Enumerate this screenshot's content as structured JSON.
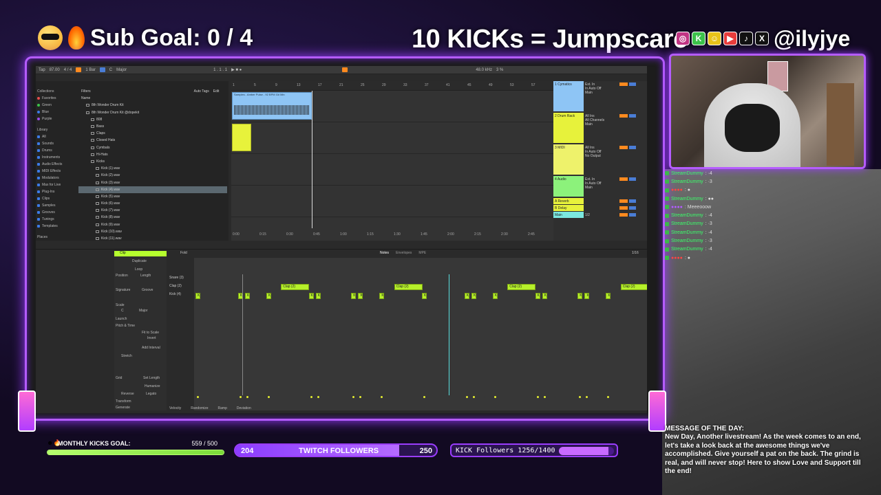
{
  "overlay": {
    "sub_goal": "Sub Goal:  0 / 4",
    "jumpscare": "10 KICKs = Jumpscare",
    "handle": "@ilyjye",
    "social_icons": [
      "instagram-icon",
      "kick-icon",
      "snapchat-icon",
      "youtube-icon",
      "tiktok-icon",
      "x-icon"
    ]
  },
  "daw": {
    "transport": {
      "tempo": "87.00",
      "sig": "4 / 4",
      "bar": "1 Bar",
      "key": "C",
      "scale": "Major",
      "pos": "1 . 1 . 1",
      "cpu": "3 %",
      "sample_rate": "48.0 kHz"
    },
    "browser": {
      "collections_header": "Collections",
      "collections": [
        {
          "label": "Favorites",
          "color": "#e84c4c"
        },
        {
          "label": "Green",
          "color": "#3cc24a"
        },
        {
          "label": "Blue",
          "color": "#3c7be8"
        },
        {
          "label": "Purple",
          "color": "#9a4ce8"
        }
      ],
      "library_header": "Library",
      "library": [
        "All",
        "Sounds",
        "Drums",
        "Instruments",
        "Audio Effects",
        "MIDI Effects",
        "Modulators",
        "Max for Live",
        "Plug-Ins",
        "Clips",
        "Samples",
        "Grooves",
        "Tunings",
        "Templates"
      ],
      "places_header": "Places",
      "filters_label": "Filters",
      "auto_tags": "Auto Tags",
      "edit": "Edit",
      "name_header": "Name",
      "files": [
        {
          "label": "8th Wonder Drum Kit",
          "indent": 1,
          "folder": true
        },
        {
          "label": "8th Wonder Drum Kit @dopekit",
          "indent": 1,
          "folder": true
        },
        {
          "label": "808",
          "indent": 2,
          "folder": true
        },
        {
          "label": "Bass",
          "indent": 2,
          "folder": true
        },
        {
          "label": "Claps",
          "indent": 2,
          "folder": true
        },
        {
          "label": "Closed Hats",
          "indent": 2,
          "folder": true
        },
        {
          "label": "Cymbals",
          "indent": 2,
          "folder": true
        },
        {
          "label": "Hi-Hats",
          "indent": 2,
          "folder": true
        },
        {
          "label": "Kicks",
          "indent": 2,
          "folder": true
        },
        {
          "label": "Kick (1).wav",
          "indent": 3,
          "folder": false
        },
        {
          "label": "Kick (2).wav",
          "indent": 3,
          "folder": false
        },
        {
          "label": "Kick (3).wav",
          "indent": 3,
          "folder": false
        },
        {
          "label": "Kick (4).wav",
          "indent": 3,
          "folder": false,
          "selected": true
        },
        {
          "label": "Kick (5).wav",
          "indent": 3,
          "folder": false
        },
        {
          "label": "Kick (6).wav",
          "indent": 3,
          "folder": false
        },
        {
          "label": "Kick (7).wav",
          "indent": 3,
          "folder": false
        },
        {
          "label": "Kick (8).wav",
          "indent": 3,
          "folder": false
        },
        {
          "label": "Kick (9).wav",
          "indent": 3,
          "folder": false
        },
        {
          "label": "Kick (10).wav",
          "indent": 3,
          "folder": false
        },
        {
          "label": "Kick (11).wav",
          "indent": 3,
          "folder": false
        }
      ]
    },
    "arrangement": {
      "ruler": [
        "1",
        "5",
        "9",
        "13",
        "17",
        "21",
        "25",
        "29",
        "33",
        "37",
        "41",
        "45",
        "49",
        "53",
        "57"
      ],
      "audio_clip_name": "Samples - Amber Pulse - 92 BPM G# Min",
      "time_labels": [
        "0:00",
        "0:15",
        "0:30",
        "0:45",
        "1:00",
        "1:15",
        "1:30",
        "1:45",
        "2:00",
        "2:15",
        "2:30",
        "2:45"
      ]
    },
    "tracks": [
      {
        "name": "1 Cymatics",
        "color": "#8ec5f5",
        "input": "Ext. In",
        "mode": "In Auto Off",
        "out": "Main"
      },
      {
        "name": "2 Drum Rack",
        "color": "#e7f23b",
        "input": "All Ins",
        "mode": "All Channels",
        "out": "Main"
      },
      {
        "name": "3 MIDI",
        "color": "#eef26b",
        "input": "All Ins",
        "mode": "In Auto Off",
        "out": "No Output"
      },
      {
        "name": "4 Audio",
        "color": "#8cf27b",
        "input": "Ext. In",
        "mode": "In Auto Off",
        "out": "Main"
      },
      {
        "name": "A Reverb",
        "color": "#e7f23b",
        "input": "",
        "mode": "",
        "out": ""
      },
      {
        "name": "B Delay",
        "color": "#e7f23b",
        "input": "",
        "mode": "",
        "out": ""
      },
      {
        "name": "Main",
        "color": "#7be8e0",
        "input": "",
        "mode": "1/2",
        "out": ""
      }
    ],
    "clip_editor": {
      "clip_label": "Clip",
      "fold": "Fold",
      "duplicate": "Duplicate",
      "loop": "Loop",
      "position": "Position",
      "length": "Length",
      "signature": "Signature",
      "groove": "Groove",
      "scale": "Scale",
      "scale_key": "C",
      "scale_mode": "Major",
      "launch": "Launch",
      "pitch_time": "Pitch & Time",
      "fit_to_scale": "Fit to Scale",
      "invert": "Invert",
      "add_interval": "Add Interval",
      "stretch": "Stretch",
      "grid": "Grid",
      "legato": "Legato",
      "reverse": "Reverse",
      "humanize": "Humanize",
      "set_length": "Set Length",
      "transform": "Transform",
      "generate": "Generate",
      "lanes": [
        "Snare (3)",
        "Clap (2)",
        "Kick (4)"
      ],
      "tabs": [
        "Notes",
        "Envelopes",
        "MPE"
      ],
      "grid_value": "1/16",
      "footer": [
        "Velocity",
        "Randomize",
        "Ramp",
        "Deviation"
      ],
      "notes_label_clap": "Clap (2)",
      "notes_label_kick": "K"
    }
  },
  "chat": [
    {
      "user": "StreamDummy",
      "msg": ": ·4",
      "kind": "green"
    },
    {
      "user": "StreamDummy",
      "msg": ": ·3",
      "kind": "green"
    },
    {
      "user": "●●●●",
      "msg": ": ●",
      "kind": "red"
    },
    {
      "user": "StreamDummy",
      "msg": ": ●●",
      "kind": "green"
    },
    {
      "user": "●●●●",
      "msg": ": Meeeooow",
      "kind": "purple"
    },
    {
      "user": "StreamDummy",
      "msg": ": ·4",
      "kind": "green"
    },
    {
      "user": "StreamDummy",
      "msg": ": ·3",
      "kind": "green"
    },
    {
      "user": "StreamDummy",
      "msg": ": ·4",
      "kind": "green"
    },
    {
      "user": "StreamDummy",
      "msg": ": ·3",
      "kind": "green"
    },
    {
      "user": "StreamDummy",
      "msg": ": ·4",
      "kind": "green"
    },
    {
      "user": "●●●●",
      "msg": ": ●",
      "kind": "red"
    }
  ],
  "motd": {
    "title": "MESSAGE OF THE DAY:",
    "body": "New Day, Another livestream! As the week comes to an end, let's take a look back at the awesome things we've accomplished. Give yourself a pat on the back. The grind is real, and will never stop! Here to show Love and Support till the end!"
  },
  "goals": {
    "monthly_kicks_label": "MONTHLY KICKS GOAL:",
    "monthly_kicks_value": "559  /  500",
    "monthly_kicks_fraction": 1.0,
    "twitch_current": "204",
    "twitch_label": "TWITCH FOLLOWERS",
    "twitch_target": "250",
    "twitch_fraction": 0.816,
    "kick_followers": "KICK Followers 1256/1400",
    "kick_fraction": 0.897
  },
  "colors": {
    "neon": "#b55cff",
    "accent_green": "#b6ff2e",
    "daw_orange": "#ff8a1f"
  }
}
